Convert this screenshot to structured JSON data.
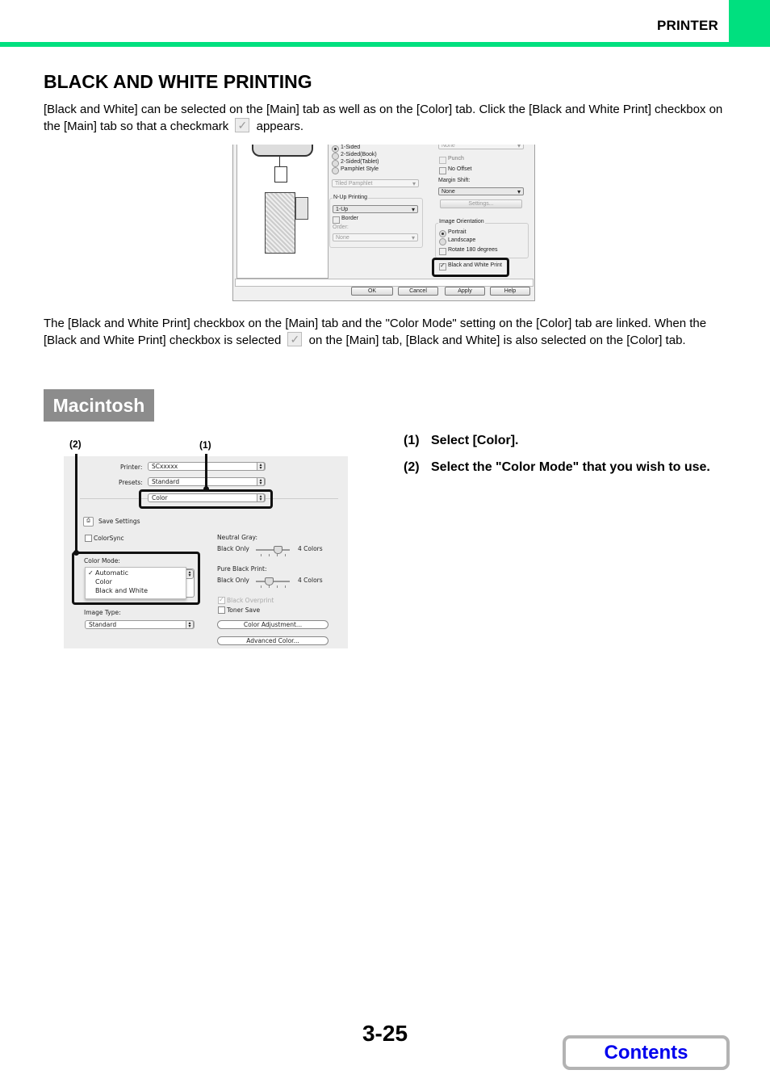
{
  "header": {
    "section_label": "PRINTER",
    "accent_color": "#00e07f"
  },
  "page": {
    "title": "BLACK AND WHITE PRINTING",
    "intro_part1": "[Black and White] can be selected on the [Main] tab as well as on the [Color] tab. Click the [Black and White Print] checkbox on the [Main] tab so that a checkmark",
    "intro_part2": "appears.",
    "linked_part1": "The [Black and White Print] checkbox on the [Main] tab and the \"Color Mode\" setting on the [Color] tab are linked. When the [Black and White Print] checkbox is selected",
    "linked_part2": "on the [Main] tab, [Black and White] is also selected on the [Color] tab.",
    "checkmark_icon": "checkbox-checked-icon",
    "page_number": "3-25",
    "contents_label": "Contents"
  },
  "windows_dialog": {
    "print_mode_options": [
      {
        "label": "1-Sided",
        "selected": true
      },
      {
        "label": "2-Sided(Book)",
        "selected": false
      },
      {
        "label": "2-Sided(Tablet)",
        "selected": false
      },
      {
        "label": "Pamphlet Style",
        "selected": false
      }
    ],
    "pamphlet_select": "Tiled Pamphlet",
    "nup_group_label": "N-Up Printing",
    "nup_select": "1-Up",
    "border_label": "Border",
    "order_label": "Order:",
    "order_select": "None",
    "staple_select": "None",
    "punch_label": "Punch",
    "no_offset_label": "No Offset",
    "margin_shift_label": "Margin Shift:",
    "margin_shift_select": "None",
    "settings_button": "Settings...",
    "orientation_group_label": "Image Orientation",
    "portrait_label": "Portrait",
    "landscape_label": "Landscape",
    "rotate_label": "Rotate 180 degrees",
    "bw_print_label": "Black and White Print",
    "bw_print_checked": true,
    "buttons": {
      "ok": "OK",
      "cancel": "Cancel",
      "apply": "Apply",
      "help": "Help"
    }
  },
  "mac_section": {
    "badge": "Macintosh",
    "callouts": {
      "one": "(1)",
      "two": "(2)"
    },
    "dialog": {
      "printer_label": "Printer:",
      "printer_value": "SCxxxxx",
      "presets_label": "Presets:",
      "presets_value": "Standard",
      "panel_value": "Color",
      "save_settings": "Save Settings",
      "colorsync_label": "ColorSync",
      "color_mode_label": "Color Mode:",
      "color_mode_options": [
        {
          "label": "Automatic",
          "checked": true
        },
        {
          "label": "Color",
          "checked": false
        },
        {
          "label": "Black and White",
          "checked": false
        }
      ],
      "image_type_label": "Image Type:",
      "image_type_value": "Standard",
      "neutral_gray_label": "Neutral Gray:",
      "neutral_gray_min": "Black Only",
      "neutral_gray_max": "4 Colors",
      "neutral_gray_position": "3 of 4",
      "pure_black_label": "Pure Black Print:",
      "pure_black_min": "Black Only",
      "pure_black_max": "4 Colors",
      "pure_black_position": "2 of 4",
      "black_overprint_label": "Black Overprint",
      "toner_save_label": "Toner Save",
      "color_adjustment_button": "Color Adjustment...",
      "advanced_color_button": "Advanced Color..."
    },
    "steps": [
      {
        "num": "(1)",
        "text": "Select [Color]."
      },
      {
        "num": "(2)",
        "text": "Select the \"Color Mode\" that you wish to use."
      }
    ]
  }
}
